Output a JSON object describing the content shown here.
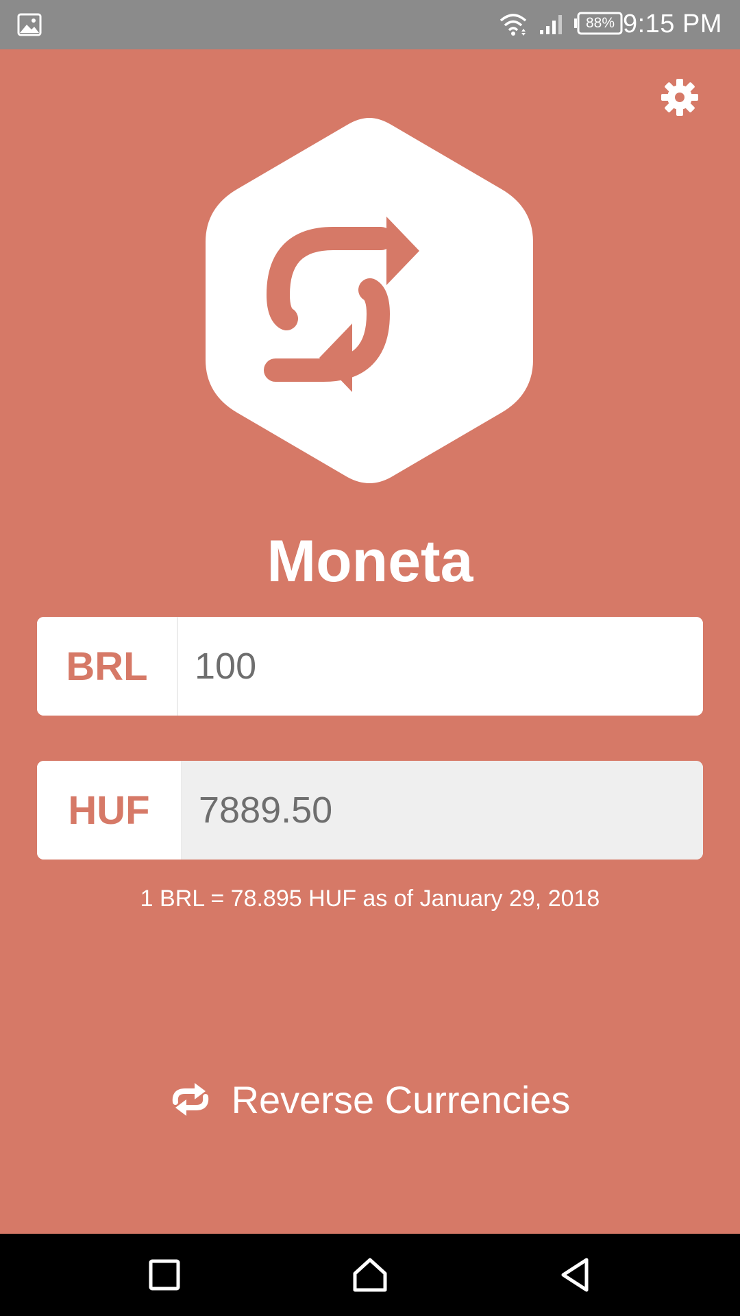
{
  "status_bar": {
    "battery": "88%",
    "time": "9:15 PM",
    "icons": [
      "gallery-icon",
      "wifi-icon",
      "signal-icon",
      "battery-icon"
    ]
  },
  "header": {
    "settings_icon": "gear-icon"
  },
  "app": {
    "title": "Moneta",
    "logo_icon": "swap-arrows-icon"
  },
  "converter": {
    "from": {
      "code": "BRL",
      "amount": "100"
    },
    "to": {
      "code": "HUF",
      "amount": "7889.50"
    },
    "rate_info": "1 BRL = 78.895 HUF as of January 29, 2018"
  },
  "reverse_button": {
    "label": "Reverse Currencies",
    "icon": "repeat-icon"
  },
  "nav_bar": {
    "icons": [
      "recents-icon",
      "home-icon",
      "back-icon"
    ]
  },
  "colors": {
    "background": "#d67967",
    "status_bar": "#8b8b8b",
    "accent_text": "#d67967",
    "output_field": "#efefef"
  }
}
